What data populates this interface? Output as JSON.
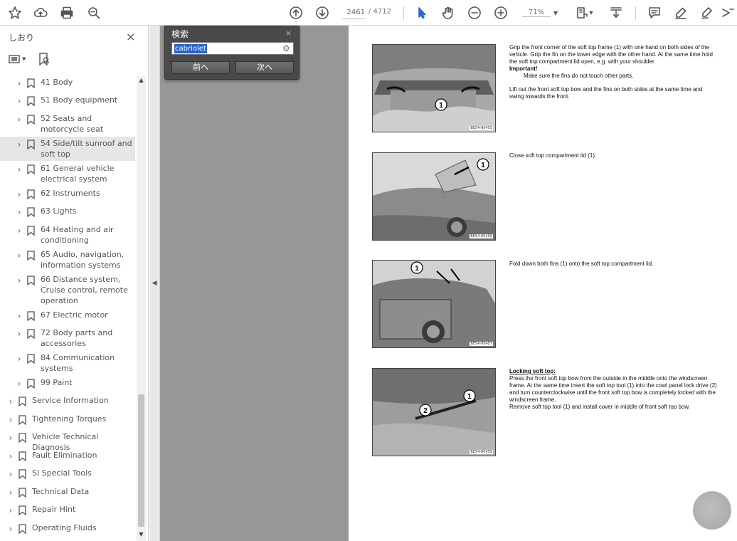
{
  "toolbar": {
    "page_current": "2461",
    "page_total": "/ 4712",
    "zoom": "71%"
  },
  "left_panel": {
    "title": "しおり",
    "close": "×",
    "items": [
      {
        "label": "41 Body",
        "level": 1
      },
      {
        "label": "51 Body equipment",
        "level": 1
      },
      {
        "label": "52 Seats and motorcycle seat",
        "level": 1
      },
      {
        "label": "54 Side/tilt sunroof and soft top",
        "level": 1,
        "selected": true
      },
      {
        "label": "61 General vehicle electrical system",
        "level": 1
      },
      {
        "label": "62 Instruments",
        "level": 1
      },
      {
        "label": "63 Lights",
        "level": 1
      },
      {
        "label": "64 Heating and air conditioning",
        "level": 1
      },
      {
        "label": "65 Audio, navigation, information systems",
        "level": 1
      },
      {
        "label": "66 Distance system, Cruise control, remote operation",
        "level": 1
      },
      {
        "label": "67 Electric motor",
        "level": 1
      },
      {
        "label": "72 Body parts and accessories",
        "level": 1
      },
      {
        "label": "84 Communication systems",
        "level": 1
      },
      {
        "label": "99 Paint",
        "level": 1
      },
      {
        "label": "Service Information",
        "level": 0
      },
      {
        "label": "Tightening Torques",
        "level": 0
      },
      {
        "label": "Vehicle Technical Diagnosis",
        "level": 0
      },
      {
        "label": "Fault Elimination",
        "level": 0
      },
      {
        "label": "SI Special Tools",
        "level": 0
      },
      {
        "label": "Technical Data",
        "level": 0
      },
      {
        "label": "Repair Hint",
        "level": 0
      },
      {
        "label": "Operating Fluids",
        "level": 0
      }
    ]
  },
  "find": {
    "title": "検索",
    "close": "×",
    "query": "cabriolet",
    "prev": "前へ",
    "next": "次へ"
  },
  "page": {
    "figures": [
      {
        "code": "BE54-80455",
        "callouts": [
          "1"
        ]
      },
      {
        "code": "BE54-80456",
        "callouts": [
          "1"
        ]
      },
      {
        "code": "BE54-80457",
        "callouts": [
          "1"
        ]
      },
      {
        "code": "BE54-80459",
        "callouts": [
          "1",
          "2"
        ]
      }
    ],
    "step1": {
      "p1": "Grip the front corner of the soft top frame (1) with one hand on both sides of the vehicle. Grip the fin on the lower edge with the other hand. At the same time hold the soft top compartment lid open, e.g. with your shoulder.",
      "important": "Important!",
      "note": "Make sure the fins do not touch other parts.",
      "p2": "Lift out the front soft top bow and the fins on both sides at the same time and swing towards the front."
    },
    "step2": "Close soft top compartment lid (1).",
    "step3": "Fold down both fins (1) onto the soft top compartment lid.",
    "step4": {
      "heading": "Locking soft top:",
      "p1": "Press the front soft top bow from the outside in the middle onto the windscreen frame. At the same time insert the soft top tool (1) into the cowl panel lock drive (2) and turn counterclockwise until the front soft top bow is completely locked with the windscreen frame.",
      "p2": "Remove soft top tool (1) and install cover in middle of front soft top bow."
    }
  }
}
